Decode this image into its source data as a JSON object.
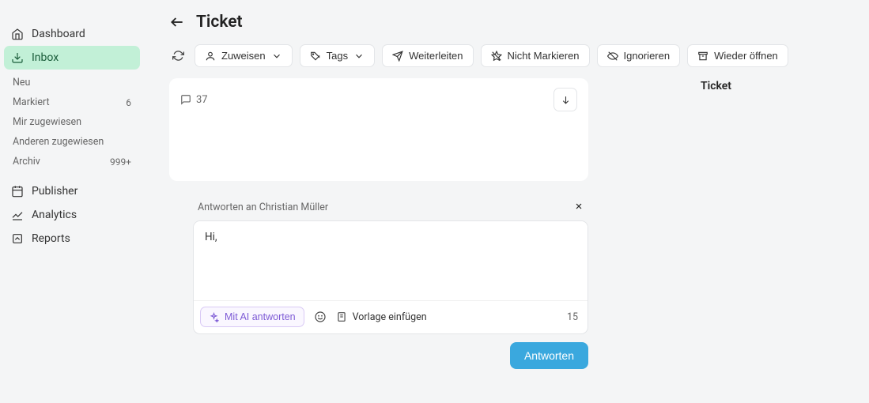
{
  "sidebar": {
    "main": [
      {
        "label": "Dashboard",
        "icon": "home-icon"
      },
      {
        "label": "Inbox",
        "icon": "inbox-icon",
        "active": true
      }
    ],
    "sub": [
      {
        "label": "Neu",
        "count": ""
      },
      {
        "label": "Markiert",
        "count": "6"
      },
      {
        "label": "Mir zugewiesen",
        "count": ""
      },
      {
        "label": "Anderen zugewiesen",
        "count": ""
      },
      {
        "label": "Archiv",
        "count": "999+"
      }
    ],
    "bottom": [
      {
        "label": "Publisher"
      },
      {
        "label": "Analytics"
      },
      {
        "label": "Reports"
      }
    ]
  },
  "header": {
    "title": "Ticket"
  },
  "toolbar": {
    "assign": "Zuweisen",
    "tags": "Tags",
    "forward": "Weiterleiten",
    "unmark": "Nicht Markieren",
    "ignore": "Ignorieren",
    "reopen": "Wieder öffnen"
  },
  "conversation": {
    "comment_count": "37"
  },
  "meta": {
    "title": "Ticket"
  },
  "reply": {
    "to_label": "Antworten an Christian Müller",
    "value": "Hi,",
    "ai_label": "Mit AI antworten",
    "template_label": "Vorlage einfügen",
    "char_count": "15",
    "send_label": "Antworten"
  }
}
